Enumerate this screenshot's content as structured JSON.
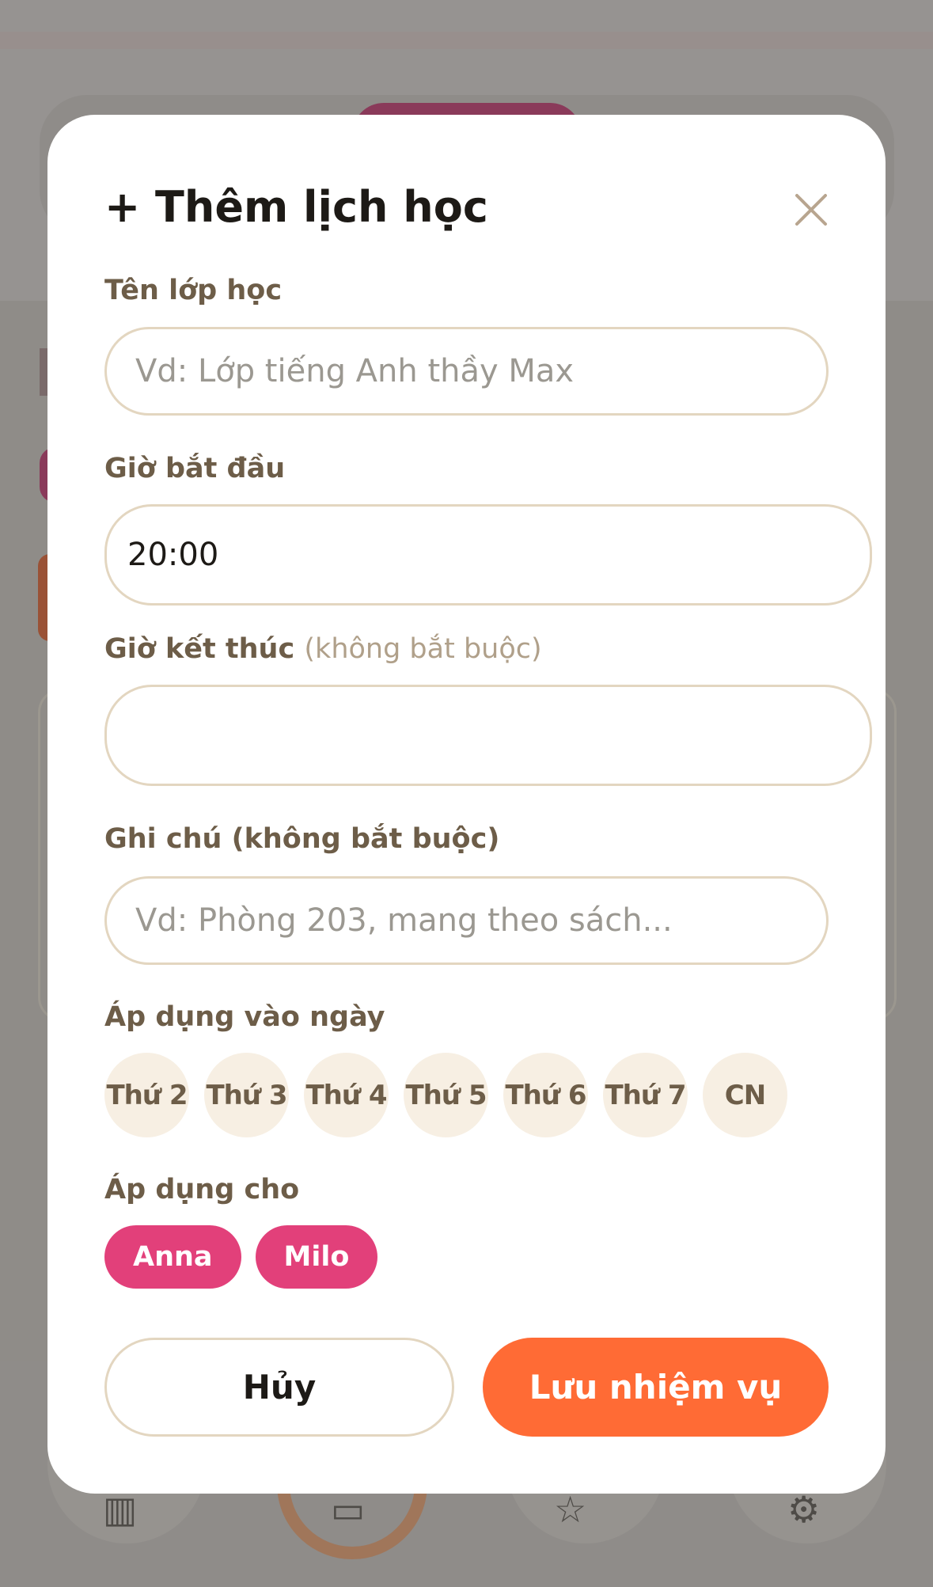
{
  "modal": {
    "title": "+ Thêm lịch học",
    "close_icon": "close-icon"
  },
  "fields": {
    "class_name": {
      "label": "Tên lớp học",
      "placeholder": "Vd: Lớp tiếng Anh thầy Max",
      "value": ""
    },
    "start_time": {
      "label": "Giờ bắt đầu",
      "value": "20:00"
    },
    "end_time": {
      "label": "Giờ kết thúc",
      "optional": "(không bắt buộc)",
      "value": ""
    },
    "note": {
      "label": "Ghi chú (không bắt buộc)",
      "placeholder": "Vd: Phòng 203, mang theo sách...",
      "value": ""
    }
  },
  "days": {
    "label": "Áp dụng vào ngày",
    "items": [
      "Thứ 2",
      "Thứ 3",
      "Thứ 4",
      "Thứ 5",
      "Thứ 6",
      "Thứ 7",
      "CN"
    ]
  },
  "children": {
    "label": "Áp dụng cho",
    "items": [
      "Anna",
      "Milo"
    ]
  },
  "actions": {
    "cancel": "Hủy",
    "save": "Lưu nhiệm vụ"
  },
  "colors": {
    "accent_orange": "#ff6b35",
    "accent_pink": "#e2407a",
    "label_brown": "#6d5d48",
    "border_beige": "#e3d6c0",
    "chip_cream": "#f7efe3"
  }
}
